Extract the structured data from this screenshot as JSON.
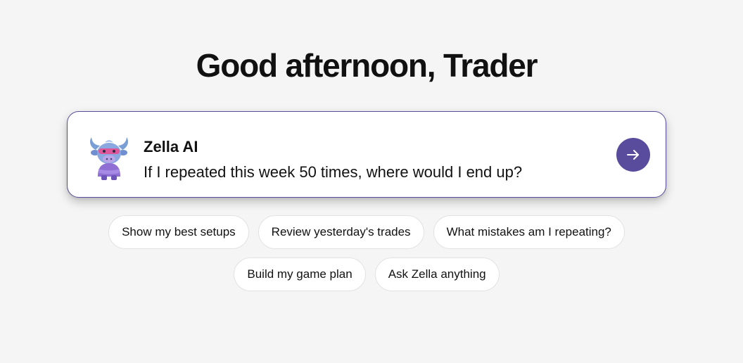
{
  "greeting": "Good afternoon, Trader",
  "prompt_card": {
    "assistant_name": "Zella AI",
    "suggestion": "If I repeated this week 50 times, where would I end up?",
    "avatar_icon": "bull-mascot-icon",
    "send_icon": "arrow-right-icon"
  },
  "chips_row1": [
    {
      "label": "Show my best setups"
    },
    {
      "label": "Review yesterday's trades"
    },
    {
      "label": "What mistakes am I repeating?"
    }
  ],
  "chips_row2": [
    {
      "label": "Build my game plan"
    },
    {
      "label": "Ask Zella anything"
    }
  ],
  "colors": {
    "accent": "#5a4c9c",
    "background": "#f5f5f5",
    "card": "#ffffff",
    "chip_border": "#e2e2e2"
  }
}
